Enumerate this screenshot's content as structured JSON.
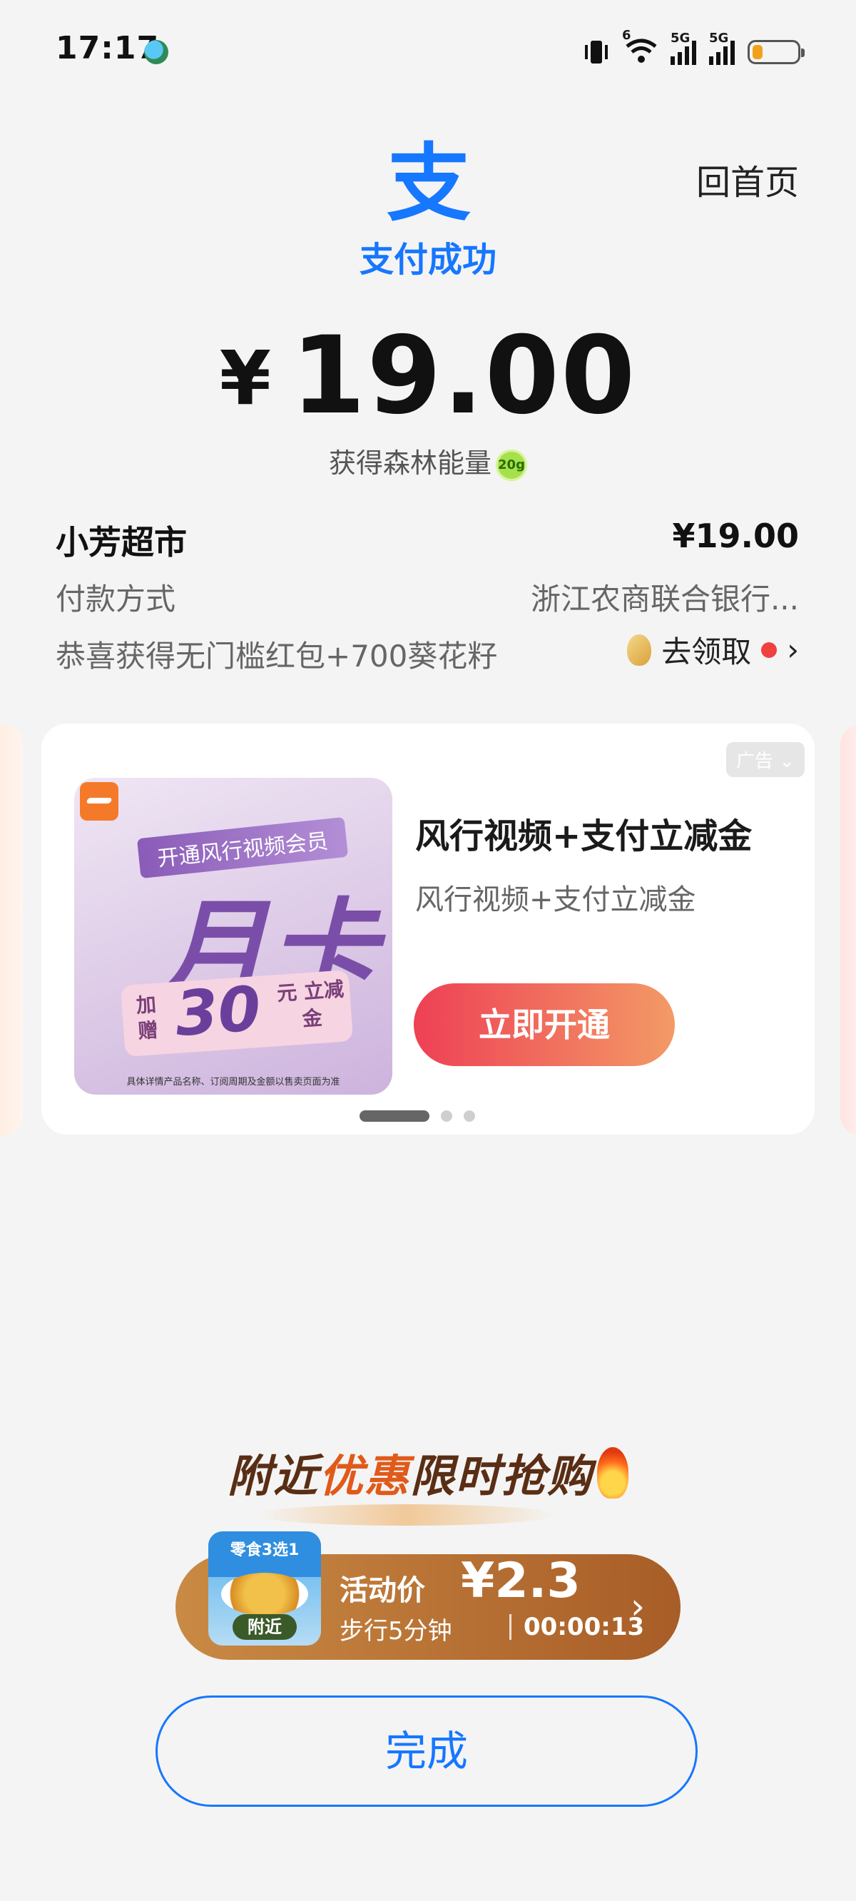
{
  "status_bar": {
    "time": "17:17",
    "icons": [
      "globe-icon",
      "vibrate-icon",
      "wifi-icon",
      "signal-icon",
      "signal-icon",
      "battery-icon"
    ],
    "wifi_label": "6",
    "sim1_label": "5G",
    "sim2_label": "5G",
    "battery_level": 0.22
  },
  "header": {
    "logo_glyph": "支",
    "title": "支付成功",
    "home_link": "回首页",
    "accent_color": "#1677ff"
  },
  "payment": {
    "currency": "¥",
    "amount": "19.00",
    "energy_text": "获得森林能量",
    "energy_badge": "20g"
  },
  "details": {
    "merchant": "小芳超市",
    "merchant_amount": "¥19.00",
    "method_label": "付款方式",
    "method_value": "浙江农商联合银行...",
    "reward_text": "恭喜获得无门槛红包+700葵花籽",
    "reward_action": "去领取"
  },
  "ad": {
    "tag": "广告",
    "image_ribbon": "开通风行视频会员",
    "image_big": "月卡",
    "image_add": "加赠",
    "image_num": "30",
    "image_unit": "元 立减金",
    "image_fine": "具体详情产品名称、订阅周期及金额以售卖页面为准",
    "title": "风行视频+支付立减金",
    "subtitle": "风行视频+支付立减金",
    "button": "立即开通",
    "carousel_index": 1,
    "carousel_count": 3
  },
  "promo": {
    "title_a": "附近",
    "title_b": "优惠",
    "title_c": "限时抢购",
    "thumb_label": "零食3选1",
    "thumb_badge": "附近",
    "price_label": "活动价",
    "price": "¥2.3",
    "walk": "步行5分钟",
    "timer": "00:00:13"
  },
  "footer": {
    "done": "完成"
  }
}
